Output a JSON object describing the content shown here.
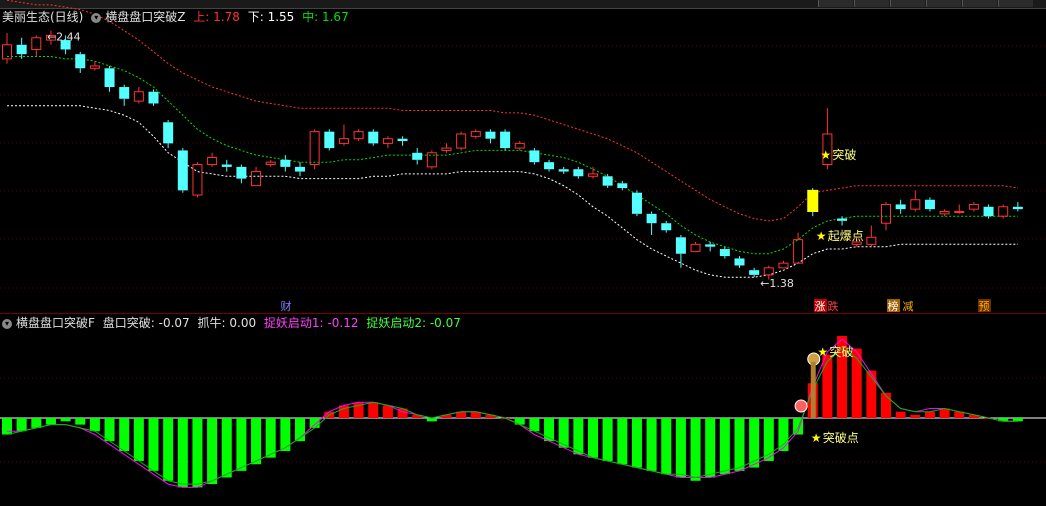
{
  "main_header": {
    "stock": "美丽生态(日线)",
    "indicator": "横盘盘口突破Z",
    "upper_label": "上:",
    "upper_value": "1.78",
    "lower_label": "下:",
    "lower_value": "1.55",
    "mid_label": "中:",
    "mid_value": "1.67"
  },
  "sub_header": {
    "indicator": "横盘盘口突破F",
    "pk_label": "盘口突破:",
    "pk_value": "-0.07",
    "zn_label": "抓牛:",
    "zn_value": "0.00",
    "s1_label": "捉妖启动1:",
    "s1_value": "-0.12",
    "s2_label": "捉妖启动2:",
    "s2_value": "-0.07"
  },
  "colors": {
    "up": "#ff3232",
    "down": "#54ffff",
    "upper_band": "#ff3232",
    "mid_band": "#00e000",
    "lower_band": "#ffffff",
    "hist_up": "#ff0000",
    "hist_down": "#00ff00",
    "hist_line1": "#ff00ff",
    "hist_line2": "#00c000",
    "star": "#ffff00"
  },
  "chart_data": [
    {
      "type": "candlestick",
      "price_range": [
        1.33,
        2.48
      ],
      "max_label": "2.44",
      "min_label": "1.38",
      "candles": [
        [
          2.34,
          2.4,
          2.45,
          2.32
        ],
        [
          2.4,
          2.36,
          2.43,
          2.34
        ],
        [
          2.38,
          2.43,
          2.44,
          2.35
        ],
        [
          2.42,
          2.44,
          2.46,
          2.4
        ],
        [
          2.42,
          2.38,
          2.44,
          2.36
        ],
        [
          2.36,
          2.3,
          2.37,
          2.28
        ],
        [
          2.3,
          2.31,
          2.33,
          2.29
        ],
        [
          2.3,
          2.22,
          2.31,
          2.2
        ],
        [
          2.22,
          2.17,
          2.23,
          2.14
        ],
        [
          2.16,
          2.2,
          2.22,
          2.15
        ],
        [
          2.2,
          2.15,
          2.21,
          2.14
        ],
        [
          2.07,
          1.98,
          2.08,
          1.96
        ],
        [
          1.95,
          1.78,
          1.96,
          1.77
        ],
        [
          1.76,
          1.89,
          1.9,
          1.75
        ],
        [
          1.89,
          1.92,
          1.94,
          1.88
        ],
        [
          1.89,
          1.88,
          1.91,
          1.86
        ],
        [
          1.88,
          1.83,
          1.89,
          1.81
        ],
        [
          1.8,
          1.86,
          1.88,
          1.8
        ],
        [
          1.89,
          1.9,
          1.91,
          1.88
        ],
        [
          1.91,
          1.88,
          1.93,
          1.86
        ],
        [
          1.88,
          1.86,
          1.9,
          1.84
        ],
        [
          1.89,
          2.03,
          2.04,
          1.87
        ],
        [
          2.03,
          1.96,
          2.04,
          1.95
        ],
        [
          1.98,
          2.0,
          2.06,
          1.97
        ],
        [
          2.0,
          2.03,
          2.04,
          1.99
        ],
        [
          2.03,
          1.98,
          2.04,
          1.97
        ],
        [
          1.98,
          2.0,
          2.01,
          1.96
        ],
        [
          2.0,
          1.99,
          2.01,
          1.97
        ],
        [
          1.94,
          1.91,
          1.96,
          1.89
        ],
        [
          1.88,
          1.94,
          1.95,
          1.87
        ],
        [
          1.95,
          1.96,
          1.98,
          1.94
        ],
        [
          1.96,
          2.02,
          2.03,
          1.95
        ],
        [
          2.01,
          2.03,
          2.04,
          2.0
        ],
        [
          2.03,
          2.0,
          2.04,
          1.98
        ],
        [
          2.03,
          1.96,
          2.04,
          1.95
        ],
        [
          1.96,
          1.98,
          1.99,
          1.95
        ],
        [
          1.95,
          1.9,
          1.96,
          1.89
        ],
        [
          1.9,
          1.87,
          1.91,
          1.86
        ],
        [
          1.87,
          1.86,
          1.88,
          1.85
        ],
        [
          1.87,
          1.84,
          1.88,
          1.83
        ],
        [
          1.84,
          1.85,
          1.88,
          1.83
        ],
        [
          1.84,
          1.8,
          1.85,
          1.79
        ],
        [
          1.81,
          1.79,
          1.82,
          1.78
        ],
        [
          1.77,
          1.68,
          1.78,
          1.67
        ],
        [
          1.68,
          1.64,
          1.69,
          1.59
        ],
        [
          1.64,
          1.61,
          1.65,
          1.6
        ],
        [
          1.58,
          1.51,
          1.59,
          1.45
        ],
        [
          1.52,
          1.55,
          1.56,
          1.52
        ],
        [
          1.55,
          1.54,
          1.56,
          1.52
        ],
        [
          1.53,
          1.5,
          1.54,
          1.49
        ],
        [
          1.49,
          1.46,
          1.5,
          1.45
        ],
        [
          1.44,
          1.42,
          1.45,
          1.41
        ],
        [
          1.42,
          1.45,
          1.46,
          1.4
        ],
        [
          1.45,
          1.47,
          1.48,
          1.45
        ],
        [
          1.47,
          1.57,
          1.6,
          1.47
        ],
        [
          1.78,
          1.69,
          1.79,
          1.67
        ],
        [
          1.89,
          2.02,
          2.13,
          1.87
        ],
        [
          1.66,
          1.65,
          1.67,
          1.63
        ],
        [
          1.55,
          1.56,
          1.58,
          1.54
        ],
        [
          1.55,
          1.58,
          1.63,
          1.54
        ],
        [
          1.64,
          1.72,
          1.73,
          1.61
        ],
        [
          1.72,
          1.7,
          1.74,
          1.68
        ],
        [
          1.7,
          1.74,
          1.78,
          1.69
        ],
        [
          1.74,
          1.7,
          1.75,
          1.69
        ],
        [
          1.68,
          1.69,
          1.7,
          1.67
        ],
        [
          1.69,
          1.69,
          1.72,
          1.68
        ],
        [
          1.7,
          1.72,
          1.73,
          1.69
        ],
        [
          1.71,
          1.67,
          1.72,
          1.66
        ],
        [
          1.67,
          1.71,
          1.72,
          1.66
        ],
        [
          1.71,
          1.7,
          1.73,
          1.69
        ]
      ],
      "upper_band": [
        2.59,
        2.58,
        2.57,
        2.57,
        2.56,
        2.55,
        2.53,
        2.5,
        2.46,
        2.42,
        2.37,
        2.32,
        2.28,
        2.25,
        2.22,
        2.2,
        2.18,
        2.16,
        2.15,
        2.14,
        2.13,
        2.13,
        2.13,
        2.13,
        2.13,
        2.13,
        2.13,
        2.12,
        2.12,
        2.12,
        2.12,
        2.12,
        2.12,
        2.12,
        2.11,
        2.11,
        2.1,
        2.08,
        2.06,
        2.04,
        2.02,
        2.0,
        1.97,
        1.94,
        1.9,
        1.86,
        1.82,
        1.78,
        1.74,
        1.71,
        1.68,
        1.66,
        1.65,
        1.66,
        1.71,
        1.77,
        1.78,
        1.79,
        1.8,
        1.8,
        1.8,
        1.8,
        1.8,
        1.8,
        1.8,
        1.8,
        1.8,
        1.8,
        1.8,
        1.79
      ],
      "mid_band": [
        2.35,
        2.35,
        2.35,
        2.35,
        2.34,
        2.34,
        2.33,
        2.31,
        2.29,
        2.26,
        2.22,
        2.16,
        2.1,
        2.04,
        2.0,
        1.97,
        1.95,
        1.93,
        1.92,
        1.91,
        1.9,
        1.9,
        1.9,
        1.91,
        1.91,
        1.92,
        1.93,
        1.93,
        1.93,
        1.93,
        1.93,
        1.94,
        1.95,
        1.95,
        1.95,
        1.95,
        1.94,
        1.93,
        1.92,
        1.9,
        1.87,
        1.84,
        1.8,
        1.76,
        1.72,
        1.68,
        1.63,
        1.59,
        1.56,
        1.54,
        1.52,
        1.51,
        1.51,
        1.53,
        1.57,
        1.62,
        1.65,
        1.66,
        1.67,
        1.67,
        1.67,
        1.67,
        1.67,
        1.67,
        1.67,
        1.67,
        1.67,
        1.67,
        1.67,
        1.67
      ],
      "lower_band": [
        2.14,
        2.14,
        2.14,
        2.14,
        2.14,
        2.14,
        2.13,
        2.12,
        2.1,
        2.07,
        2.01,
        1.94,
        1.9,
        1.86,
        1.85,
        1.84,
        1.84,
        1.84,
        1.84,
        1.84,
        1.83,
        1.83,
        1.83,
        1.83,
        1.83,
        1.84,
        1.84,
        1.85,
        1.85,
        1.85,
        1.85,
        1.86,
        1.86,
        1.86,
        1.86,
        1.86,
        1.85,
        1.83,
        1.8,
        1.76,
        1.71,
        1.67,
        1.62,
        1.57,
        1.53,
        1.5,
        1.47,
        1.44,
        1.42,
        1.41,
        1.41,
        1.41,
        1.42,
        1.44,
        1.47,
        1.51,
        1.53,
        1.53,
        1.54,
        1.54,
        1.54,
        1.55,
        1.55,
        1.55,
        1.55,
        1.55,
        1.55,
        1.55,
        1.55,
        1.55
      ],
      "annotations": {
        "breakout": "突破",
        "ignition": "起爆点",
        "max_arrow": "←",
        "min_arrow": "←"
      },
      "markers": [
        {
          "text": "财",
          "color": "#8080ff",
          "bg": ""
        },
        {
          "text": "涨",
          "color": "#ffffff",
          "bg": "#c00000"
        },
        {
          "text": "跌",
          "color": "#ff4040",
          "bg": ""
        },
        {
          "text": "榜",
          "color": "#ffffff",
          "bg": "#a06000"
        },
        {
          "text": "减",
          "color": "#ffb000",
          "bg": ""
        },
        {
          "text": "预",
          "color": "#ffb000",
          "bg": "#6a3000"
        }
      ]
    },
    {
      "type": "bar",
      "value_range": [
        -0.23,
        0.26
      ],
      "histogram": [
        -0.05,
        -0.04,
        -0.03,
        -0.02,
        -0.01,
        -0.02,
        -0.04,
        -0.07,
        -0.1,
        -0.13,
        -0.16,
        -0.19,
        -0.21,
        -0.21,
        -0.2,
        -0.18,
        -0.16,
        -0.14,
        -0.12,
        -0.1,
        -0.07,
        -0.03,
        0.02,
        0.04,
        0.05,
        0.05,
        0.04,
        0.03,
        0.01,
        -0.01,
        0.01,
        0.02,
        0.02,
        0.01,
        0.0,
        -0.02,
        -0.04,
        -0.07,
        -0.09,
        -0.11,
        -0.12,
        -0.13,
        -0.14,
        -0.15,
        -0.16,
        -0.17,
        -0.18,
        -0.19,
        -0.18,
        -0.17,
        -0.16,
        -0.15,
        -0.13,
        -0.1,
        -0.05,
        0.11,
        0.2,
        0.26,
        0.22,
        0.15,
        0.08,
        0.02,
        0.01,
        0.02,
        0.03,
        0.02,
        0.01,
        0.0,
        -0.01,
        -0.01
      ],
      "line1": [
        -0.04,
        -0.04,
        -0.03,
        -0.02,
        -0.02,
        -0.03,
        -0.05,
        -0.08,
        -0.11,
        -0.14,
        -0.17,
        -0.2,
        -0.21,
        -0.21,
        -0.19,
        -0.17,
        -0.15,
        -0.13,
        -0.11,
        -0.09,
        -0.06,
        -0.02,
        0.02,
        0.04,
        0.05,
        0.05,
        0.04,
        0.02,
        0.01,
        0.0,
        0.01,
        0.02,
        0.02,
        0.01,
        0.0,
        -0.02,
        -0.05,
        -0.07,
        -0.09,
        -0.11,
        -0.12,
        -0.13,
        -0.14,
        -0.15,
        -0.16,
        -0.17,
        -0.18,
        -0.18,
        -0.18,
        -0.17,
        -0.16,
        -0.14,
        -0.12,
        -0.09,
        -0.04,
        0.1,
        0.21,
        0.25,
        0.21,
        0.14,
        0.07,
        0.03,
        0.02,
        0.03,
        0.03,
        0.02,
        0.01,
        0.0,
        -0.01,
        -0.01
      ],
      "line2": [
        -0.05,
        -0.04,
        -0.03,
        -0.02,
        -0.02,
        -0.03,
        -0.04,
        -0.07,
        -0.1,
        -0.13,
        -0.16,
        -0.19,
        -0.2,
        -0.2,
        -0.19,
        -0.17,
        -0.15,
        -0.13,
        -0.11,
        -0.09,
        -0.06,
        -0.03,
        0.01,
        0.03,
        0.04,
        0.05,
        0.04,
        0.03,
        0.01,
        0.0,
        0.01,
        0.02,
        0.02,
        0.01,
        0.0,
        -0.02,
        -0.04,
        -0.06,
        -0.08,
        -0.1,
        -0.12,
        -0.13,
        -0.14,
        -0.15,
        -0.16,
        -0.17,
        -0.17,
        -0.18,
        -0.17,
        -0.16,
        -0.15,
        -0.13,
        -0.11,
        -0.08,
        -0.03,
        0.09,
        0.18,
        0.22,
        0.19,
        0.13,
        0.07,
        0.03,
        0.02,
        0.02,
        0.03,
        0.02,
        0.01,
        0.0,
        -0.01,
        -0.01
      ],
      "annotations": {
        "breakout": "突破",
        "breakout_point": "突破点"
      }
    }
  ]
}
